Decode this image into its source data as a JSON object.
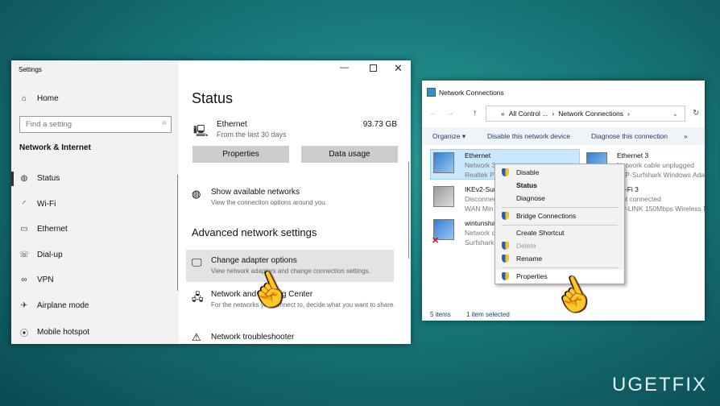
{
  "settings": {
    "title": "Settings",
    "home": "Home",
    "search_placeholder": "Find a setting",
    "section": "Network & Internet",
    "nav": [
      {
        "label": "Status",
        "icon": "globe-icon"
      },
      {
        "label": "Wi-Fi",
        "icon": "wifi-icon"
      },
      {
        "label": "Ethernet",
        "icon": "ethernet-icon"
      },
      {
        "label": "Dial-up",
        "icon": "dialup-icon"
      },
      {
        "label": "VPN",
        "icon": "vpn-icon"
      },
      {
        "label": "Airplane mode",
        "icon": "airplane-icon"
      },
      {
        "label": "Mobile hotspot",
        "icon": "hotspot-icon"
      }
    ],
    "page_title": "Status",
    "connection": {
      "name": "Ethernet",
      "sub": "From the last 30 days",
      "usage": "93.73 GB"
    },
    "properties_btn": "Properties",
    "data_usage_btn": "Data usage",
    "show_networks": {
      "title": "Show available networks",
      "sub": "View the connection options around you."
    },
    "advanced_heading": "Advanced network settings",
    "change_adapter": {
      "title": "Change adapter options",
      "sub": "View network adapters and change connection settings."
    },
    "sharing_center": {
      "title": "Network and Sharing Center",
      "sub": "For the networks you connect to, decide what you want to share."
    },
    "troubleshooter": {
      "title": "Network troubleshooter"
    }
  },
  "netconn": {
    "title": "Network Connections",
    "breadcrumb": [
      "«",
      "All Control ...",
      "›",
      "Network Connections",
      "›"
    ],
    "toolbar": {
      "organize": "Organize ▾",
      "disable": "Disable this network device",
      "diagnose": "Diagnose this connection",
      "more": "»"
    },
    "items": [
      {
        "name": "Ethernet",
        "l2": "Network 3",
        "l3": "Realtek PC"
      },
      {
        "name": "IKEv2-Surf",
        "l2": "Disconnec",
        "l3": "WAN Min"
      },
      {
        "name": "wintunsha",
        "l2": "Network c",
        "l3": "Surfshark"
      },
      {
        "name": "Ethernet 3",
        "l2": "Network cable unplugged",
        "l3": "TAP-Surfshark Windows Ada"
      },
      {
        "name": "Wi-Fi 3",
        "l2": "Not connected",
        "l3": "TP-LINK 150Mbps Wireless N"
      }
    ],
    "menu": [
      "Disable",
      "Status",
      "Diagnose",
      "Bridge Connections",
      "Create Shortcut",
      "Delete",
      "Rename",
      "Properties"
    ],
    "status_items": "5 items",
    "status_selected": "1 item selected"
  },
  "watermark": "UGETFIX"
}
